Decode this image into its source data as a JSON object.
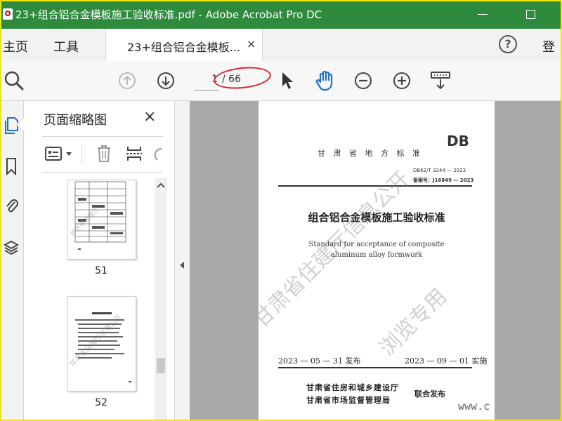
{
  "window": {
    "title": "23+组合铝合金模板施工验收标准.pdf - Adobe Acrobat Pro DC"
  },
  "menu": {
    "home": "主页",
    "tools": "工具",
    "signin": "登"
  },
  "tab": {
    "label": "23+组合铝合金模板...",
    "close": "×"
  },
  "toolbar": {
    "current_page": "1",
    "total_pages": "/ 66"
  },
  "thumbnails": {
    "title": "页面缩略图",
    "close": "×",
    "items": [
      {
        "page": "51"
      },
      {
        "page": "52"
      }
    ]
  },
  "document": {
    "db_mark": "DB",
    "province_standard": "甘 肃 省 地 方 标 准",
    "standard_no": "DB62/T 3244 — 2023",
    "record_no": "备案号：J16849 — 2023",
    "title_cn": "组合铝合金模板施工验收标准",
    "title_en_line1": "Standard for acceptance of composite",
    "title_en_line2": "aluminum alloy formwork",
    "release_date": "2023 — 05 — 31 发布",
    "implement_date": "2023 — 09 — 01 实施",
    "issuer_1": "甘肃省住房和城乡建设厅",
    "issuer_2": "甘肃省市场监督管理局",
    "joint_release": "联合发布",
    "watermark_1": "甘肃省住建厅信息公开",
    "watermark_2": "浏览专用"
  },
  "corner_text": "www.c",
  "colors": {
    "titlebar": "#2e8b3d",
    "annotation_oval": "#d9262b",
    "frame": "#f2e600"
  }
}
